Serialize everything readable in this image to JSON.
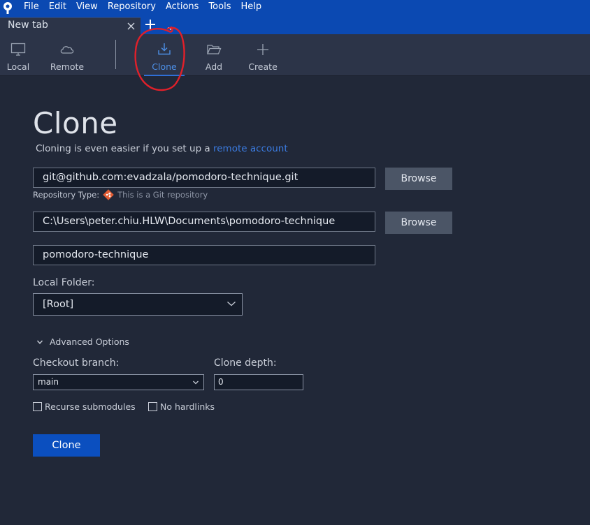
{
  "menu": [
    "File",
    "Edit",
    "View",
    "Repository",
    "Actions",
    "Tools",
    "Help"
  ],
  "tab": {
    "title": "New tab"
  },
  "toolbar": {
    "local": "Local",
    "remote": "Remote",
    "clone": "Clone",
    "add": "Add",
    "create": "Create"
  },
  "clone_page": {
    "title": "Clone",
    "subtitle_text": "Cloning is even easier if you set up a ",
    "subtitle_link": "remote account",
    "source_url": "git@github.com:evadzala/pomodoro-technique.git",
    "browse_label": "Browse",
    "repo_type_label": "Repository Type:",
    "repo_type_value": "This is a Git repository",
    "destination_path": "C:\\Users\\peter.chiu.HLW\\Documents\\pomodoro-technique",
    "name": "pomodoro-technique",
    "local_folder_label": "Local Folder:",
    "local_folder_value": "[Root]",
    "advanced_label": "Advanced Options",
    "checkout_branch_label": "Checkout branch:",
    "checkout_branch_value": "main",
    "clone_depth_label": "Clone depth:",
    "clone_depth_value": "0",
    "recurse_label": "Recurse submodules",
    "no_hardlinks_label": "No hardlinks",
    "clone_button": "Clone"
  },
  "colors": {
    "menubar": "#0b49b2",
    "background": "#212838",
    "accent": "#2f6fd6",
    "link": "#3b7be0",
    "primary_button": "#0b4fbf",
    "annotation": "#e0202a"
  },
  "icons": {
    "app": "sourcetree-logo",
    "local": "monitor-icon",
    "remote": "cloud-icon",
    "clone": "download-tray-icon",
    "add": "folder-open-icon",
    "create": "plus-icon"
  }
}
